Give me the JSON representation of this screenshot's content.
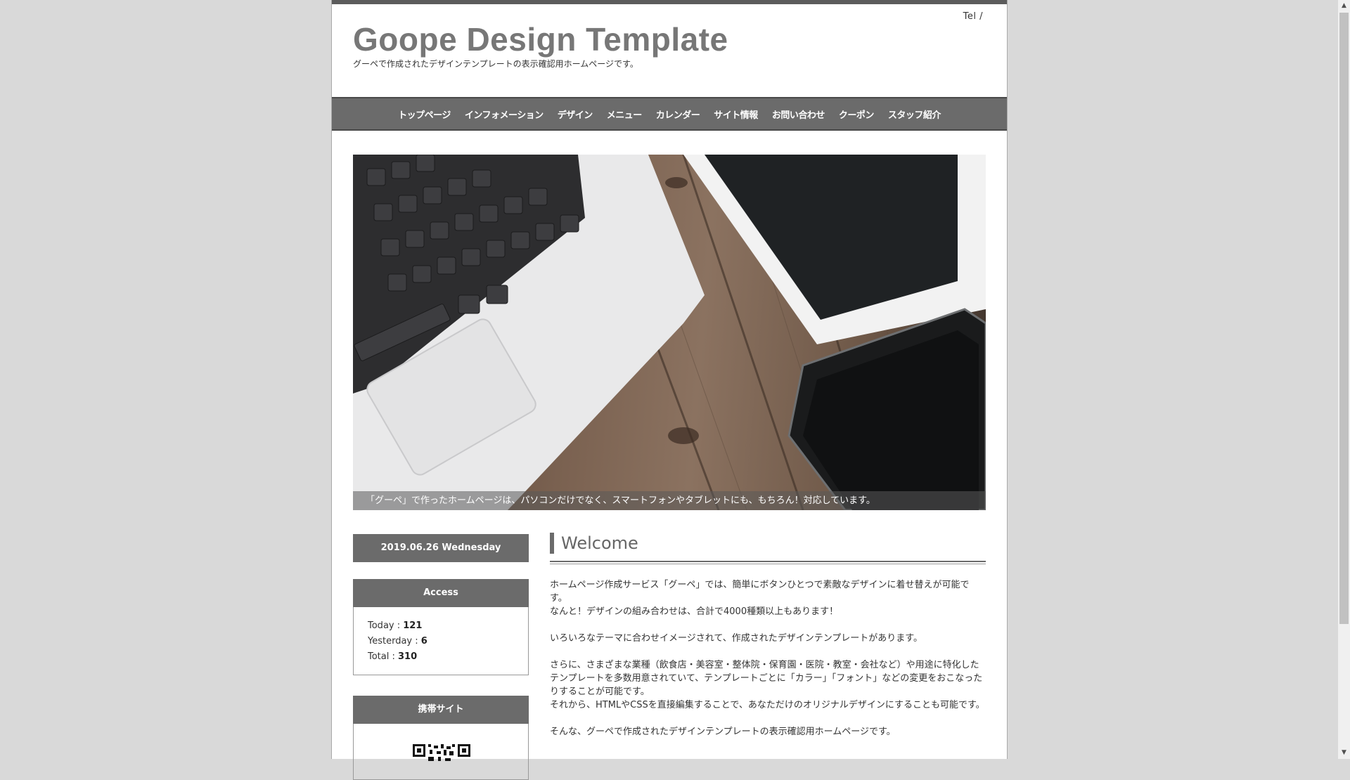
{
  "header": {
    "tel": "Tel /",
    "title": "Goope Design Template",
    "description": "グーペで作成されたデザインテンプレートの表示確認用ホームページです。"
  },
  "nav": {
    "items": [
      {
        "label": "トップページ"
      },
      {
        "label": "インフォメーション"
      },
      {
        "label": "デザイン"
      },
      {
        "label": "メニュー"
      },
      {
        "label": "カレンダー"
      },
      {
        "label": "サイト情報"
      },
      {
        "label": "お問い合わせ"
      },
      {
        "label": "クーポン"
      },
      {
        "label": "スタッフ紹介"
      }
    ]
  },
  "hero": {
    "caption": "「グーペ」で作ったホームページは、パソコンだけでなく、スマートフォンやタブレットにも、もちろん！対応しています。",
    "image_alt": "laptop, tablet and smartphone on wooden desk"
  },
  "sidebar": {
    "date": "2019.06.26 Wednesday",
    "access": {
      "title": "Access",
      "today_label": "Today : ",
      "today": "121",
      "yesterday_label": "Yesterday : ",
      "yesterday": "6",
      "total_label": "Total : ",
      "total": "310"
    },
    "mobile": {
      "title": "携帯サイト"
    }
  },
  "main": {
    "title": "Welcome",
    "paragraphs": [
      "ホームページ作成サービス「グーペ」では、簡単にボタンひとつで素敵なデザインに着せ替えが可能です。\nなんと！デザインの組み合わせは、合計で4000種類以上もあります！",
      "いろいろなテーマに合わせイメージされて、作成されたデザインテンプレートがあります。",
      "さらに、さまざまな業種（飲食店・美容室・整体院・保育園・医院・教室・会社など）や用途に特化したテンプレートを多数用意されていて、テンプレートごとに「カラー」「フォント」などの変更をおこなったりすることが可能です。\nそれから、HTMLやCSSを直接編集することで、あなただけのオリジナルデザインにすることも可能です。",
      "そんな、グーペで作成されたデザインテンプレートの表示確認用ホームページです。"
    ]
  },
  "colors": {
    "background": "#d9d9d9",
    "nav": "#6b6b6b",
    "title": "#777777"
  }
}
